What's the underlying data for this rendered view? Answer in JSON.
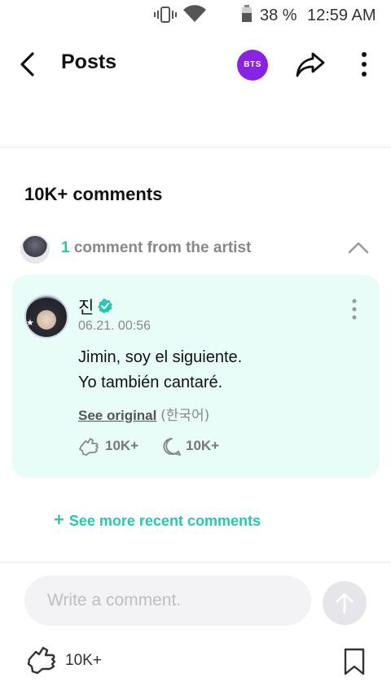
{
  "status_bar": {
    "battery_percent": "38 %",
    "time": "12:59 AM",
    "icons": [
      "vibrate-icon",
      "wifi-icon",
      "battery-icon"
    ]
  },
  "header": {
    "title": "Posts",
    "community_badge": "BTS",
    "icons": [
      "back-arrow-icon",
      "share-icon",
      "more-vertical-icon"
    ],
    "badge_color": "#8a22e4"
  },
  "comments": {
    "count_label": "10K+ comments",
    "artist_toggle": {
      "count": "1",
      "label": " comment from the artist"
    },
    "artist_comment": {
      "author": "진",
      "date": "06.21. 00:56",
      "text_lines": [
        "Jimin, soy el siguiente.",
        "Yo también cantaré."
      ],
      "see_original": "See original",
      "original_language": "(한국어)",
      "likes": "10K+",
      "replies": "10K+",
      "card_color": "#e8fdf7",
      "verified_color": "#27c7b0"
    },
    "see_more": "See more recent comments"
  },
  "composer": {
    "placeholder": "Write a comment."
  },
  "bottom_bar": {
    "likes": "10K+",
    "icons": [
      "like-hands-icon",
      "bookmark-icon"
    ]
  },
  "colors": {
    "accent": "#27c7b0",
    "muted_text": "#888888"
  }
}
